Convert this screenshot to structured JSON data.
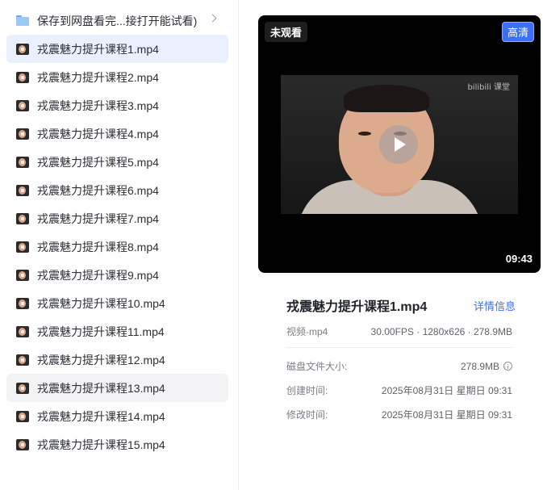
{
  "file_list": {
    "folder": {
      "label": "保存到网盘看完...接打开能试看)"
    },
    "files": [
      "戎震魅力提升课程1.mp4",
      "戎震魅力提升课程2.mp4",
      "戎震魅力提升课程3.mp4",
      "戎震魅力提升课程4.mp4",
      "戎震魅力提升课程5.mp4",
      "戎震魅力提升课程6.mp4",
      "戎震魅力提升课程7.mp4",
      "戎震魅力提升课程8.mp4",
      "戎震魅力提升课程9.mp4",
      "戎震魅力提升课程10.mp4",
      "戎震魅力提升课程11.mp4",
      "戎震魅力提升课程12.mp4",
      "戎震魅力提升课程13.mp4",
      "戎震魅力提升课程14.mp4",
      "戎震魅力提升课程15.mp4"
    ],
    "selected_index": 0,
    "hovered_index": 12
  },
  "preview": {
    "unwatched_badge": "未观看",
    "hd_badge": "高清",
    "duration": "09:43",
    "watermark": "bilibili 课堂"
  },
  "details": {
    "title": "戎震魅力提升课程1.mp4",
    "detail_link": "详情信息",
    "type": "视频-mp4",
    "specs": "30.00FPS · 1280x626 · 278.9MB",
    "rows": [
      {
        "label": "磁盘文件大小:",
        "value": "278.9MB"
      },
      {
        "label": "创建时间:",
        "value": "2025年08月31日 星期日 09:31"
      },
      {
        "label": "修改时间:",
        "value": "2025年08月31日 星期日 09:31"
      }
    ]
  },
  "colors": {
    "accent": "#3b6ff5",
    "selected_bg": "#eaf0fd",
    "hover_bg": "#f3f3f5"
  }
}
